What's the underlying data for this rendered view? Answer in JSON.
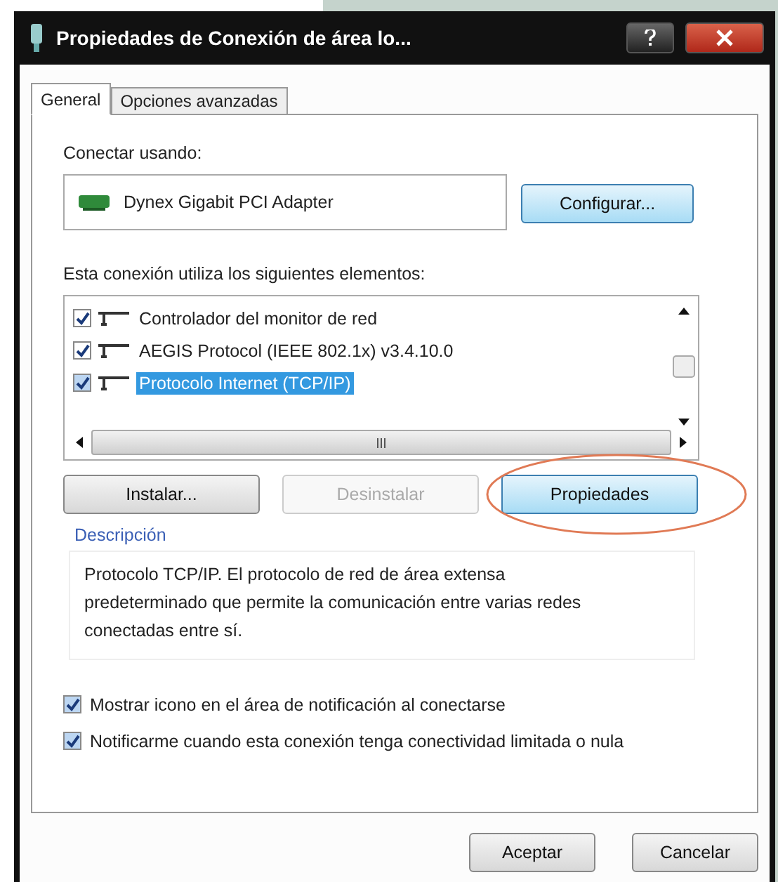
{
  "window": {
    "title": "Propiedades de Conexión de área lo..."
  },
  "tabs": [
    {
      "label": "General",
      "selected": true
    },
    {
      "label": "Opciones avanzadas",
      "selected": false
    }
  ],
  "connect_label": "Conectar usando:",
  "adapter": {
    "name": "Dynex Gigabit PCI Adapter",
    "button": "Configurar..."
  },
  "components_label": "Esta conexión utiliza los siguientes elementos:",
  "components": [
    {
      "label": "Controlador del monitor de red",
      "checked": true,
      "selected": false
    },
    {
      "label": "AEGIS Protocol (IEEE 802.1x) v3.4.10.0",
      "checked": true,
      "selected": false
    },
    {
      "label": "Protocolo Internet (TCP/IP)",
      "checked": true,
      "selected": true
    }
  ],
  "component_buttons": [
    {
      "label": "Instalar...",
      "disabled": false,
      "highlighted": false
    },
    {
      "label": "Desinstalar",
      "disabled": true,
      "highlighted": false
    },
    {
      "label": "Propiedades",
      "disabled": false,
      "highlighted": true
    }
  ],
  "description": {
    "title": "Descripción",
    "text": "Protocolo TCP/IP. El protocolo de red de área extensa predeterminado que permite la comunicación entre varias redes conectadas entre sí."
  },
  "options": [
    {
      "label": "Mostrar icono en el área de notificación al conectarse",
      "checked": true
    },
    {
      "label": "Notificarme cuando esta conexión tenga conectividad limitada o nula",
      "checked": true
    }
  ],
  "footer_buttons": [
    {
      "label": "Aceptar"
    },
    {
      "label": "Cancelar"
    }
  ]
}
